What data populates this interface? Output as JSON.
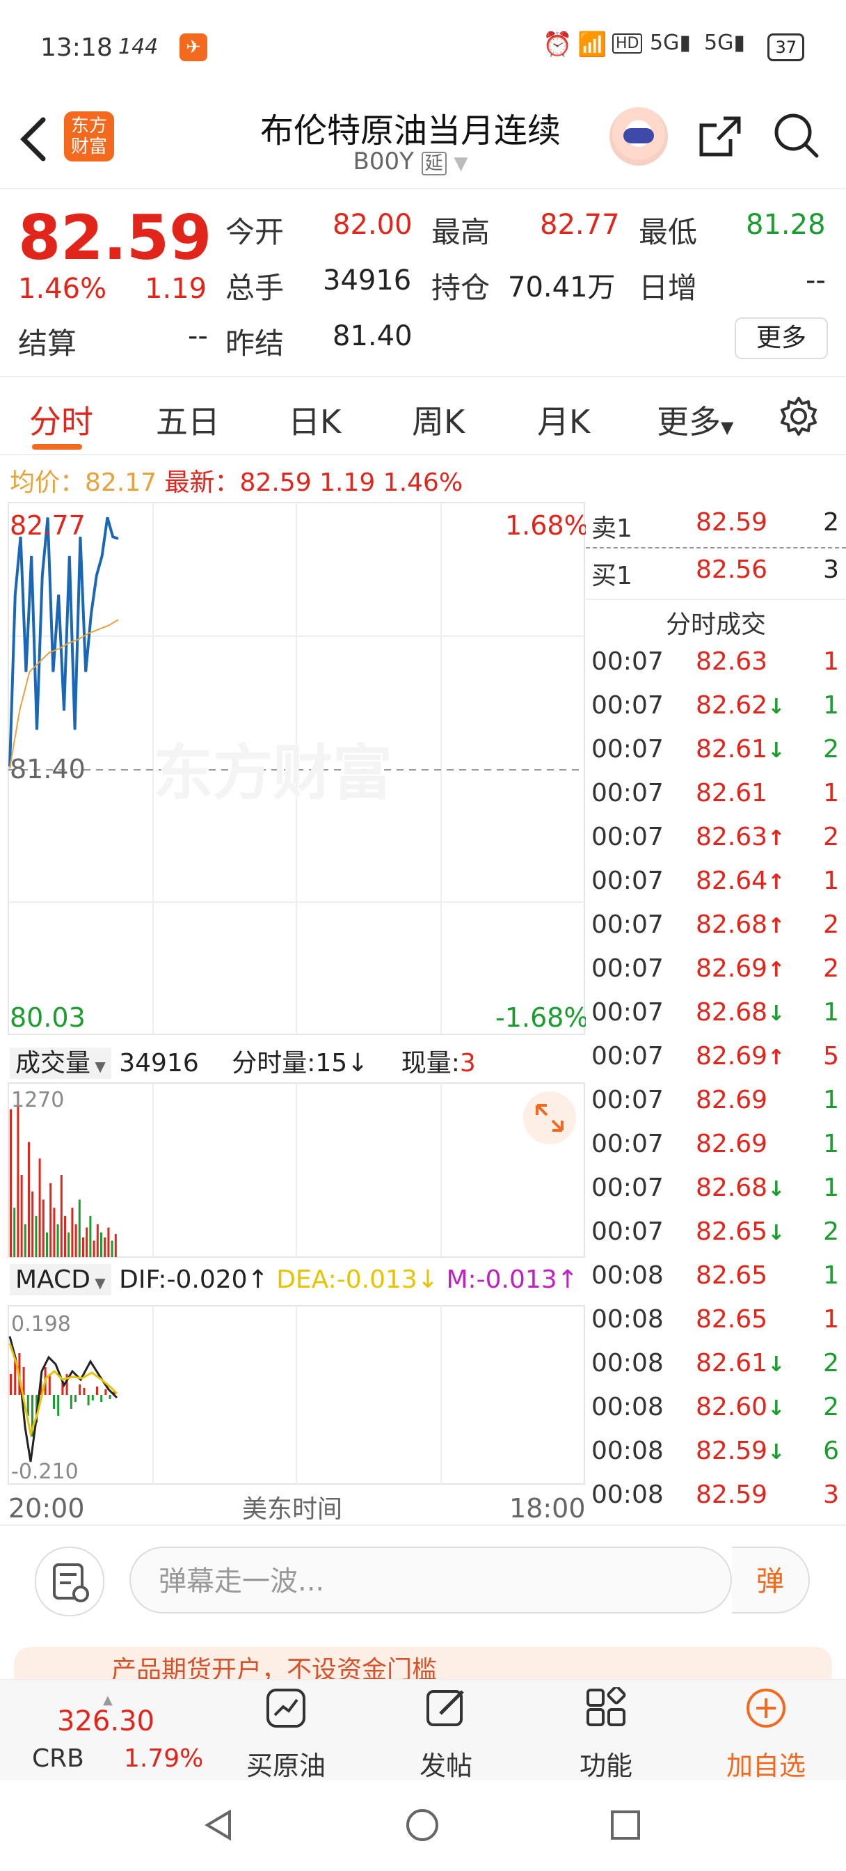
{
  "status_bar": {
    "time": "13:18",
    "refresh_rate": "144",
    "battery": "37"
  },
  "header": {
    "back_icon": "chevron-left",
    "logo_text_1": "东方",
    "logo_text_2": "财富",
    "title": "布伦特原油当月连续",
    "subtitle": "B00Y",
    "delayed_tag": "延"
  },
  "quote": {
    "price": "82.59",
    "change_pct": "1.46%",
    "change": "1.19",
    "open_label": "今开",
    "open": "82.00",
    "high_label": "最高",
    "high": "82.77",
    "low_label": "最低",
    "low": "81.28",
    "volume_label": "总手",
    "volume": "34916",
    "position_label": "持仓",
    "position": "70.41万",
    "daily_inc_label": "日增",
    "daily_inc": "--",
    "settle_label": "结算",
    "settle": "--",
    "prev_settle_label": "昨结",
    "prev_settle": "81.40",
    "more_label": "更多"
  },
  "tabs": [
    "分时",
    "五日",
    "日K",
    "周K",
    "月K",
    "更多"
  ],
  "avg_line": {
    "avg_label": "均价：",
    "avg": "82.17",
    "latest_label": "最新：",
    "latest": "82.59",
    "change": "1.19",
    "change_pct": "1.46%"
  },
  "chart": {
    "high_label": "82.77",
    "high_pct": "1.68%",
    "mid_label": "81.40",
    "low_label": "80.03",
    "low_pct": "-1.68%",
    "watermark": "东方财富",
    "vol_selector": "成交量",
    "vol_total": "34916",
    "tick_vol_label": "分时量:",
    "tick_vol": "15",
    "now_vol_label": "现量:",
    "now_vol": "3",
    "vol_max": "1270",
    "macd_selector": "MACD",
    "dif": "DIF:-0.020",
    "dea": "DEA:-0.013",
    "m": "M:-0.013",
    "macd_max": "0.198",
    "macd_min": "-0.210",
    "time_start": "20:00",
    "time_mid": "美东时间",
    "time_end": "18:00"
  },
  "chart_data": {
    "type": "line",
    "title": "",
    "ylim": [
      80.03,
      82.77
    ],
    "reference": 81.4,
    "series": [
      {
        "values": [
          81.41,
          82.3,
          82.6,
          81.9,
          82.5,
          81.6,
          82.4,
          82.7,
          81.9,
          82.3,
          81.7,
          82.5,
          81.6,
          82.6,
          81.9,
          82.2,
          82.4,
          82.5,
          82.7,
          82.6,
          82.59
        ]
      },
      {
        "values": [
          81.4,
          81.7,
          81.9,
          81.95,
          82.0,
          82.02,
          82.05,
          82.07,
          82.1,
          82.12,
          82.14,
          82.17
        ]
      }
    ]
  },
  "trades": {
    "ask_label": "卖1",
    "ask_price": "82.59",
    "ask_vol": "2",
    "bid_label": "买1",
    "bid_price": "82.56",
    "bid_vol": "3",
    "header": "分时成交",
    "rows": [
      {
        "time": "00:07",
        "price": "82.63",
        "arrow": "",
        "vol": "1",
        "dir": "r"
      },
      {
        "time": "00:07",
        "price": "82.62",
        "arrow": "↓",
        "vol": "1",
        "dir": "g"
      },
      {
        "time": "00:07",
        "price": "82.61",
        "arrow": "↓",
        "vol": "2",
        "dir": "g"
      },
      {
        "time": "00:07",
        "price": "82.61",
        "arrow": "",
        "vol": "1",
        "dir": "r"
      },
      {
        "time": "00:07",
        "price": "82.63",
        "arrow": "↑",
        "vol": "2",
        "dir": "r"
      },
      {
        "time": "00:07",
        "price": "82.64",
        "arrow": "↑",
        "vol": "1",
        "dir": "r"
      },
      {
        "time": "00:07",
        "price": "82.68",
        "arrow": "↑",
        "vol": "2",
        "dir": "r"
      },
      {
        "time": "00:07",
        "price": "82.69",
        "arrow": "↑",
        "vol": "2",
        "dir": "r"
      },
      {
        "time": "00:07",
        "price": "82.68",
        "arrow": "↓",
        "vol": "1",
        "dir": "g"
      },
      {
        "time": "00:07",
        "price": "82.69",
        "arrow": "↑",
        "vol": "5",
        "dir": "r"
      },
      {
        "time": "00:07",
        "price": "82.69",
        "arrow": "",
        "vol": "1",
        "dir": "g"
      },
      {
        "time": "00:07",
        "price": "82.69",
        "arrow": "",
        "vol": "1",
        "dir": "g"
      },
      {
        "time": "00:07",
        "price": "82.68",
        "arrow": "↓",
        "vol": "1",
        "dir": "g"
      },
      {
        "time": "00:07",
        "price": "82.65",
        "arrow": "↓",
        "vol": "2",
        "dir": "g"
      },
      {
        "time": "00:08",
        "price": "82.65",
        "arrow": "",
        "vol": "1",
        "dir": "g"
      },
      {
        "time": "00:08",
        "price": "82.65",
        "arrow": "",
        "vol": "1",
        "dir": "r"
      },
      {
        "time": "00:08",
        "price": "82.61",
        "arrow": "↓",
        "vol": "2",
        "dir": "g"
      },
      {
        "time": "00:08",
        "price": "82.60",
        "arrow": "↓",
        "vol": "2",
        "dir": "g"
      },
      {
        "time": "00:08",
        "price": "82.59",
        "arrow": "↓",
        "vol": "6",
        "dir": "g"
      },
      {
        "time": "00:08",
        "price": "82.59",
        "arrow": "",
        "vol": "3",
        "dir": "r"
      }
    ]
  },
  "comment": {
    "placeholder": "弹幕走一波...",
    "danmu_btn": "弹"
  },
  "promo": {
    "text": "产品期货开户，不设资金门槛"
  },
  "bottom_nav": {
    "crb_value": "326.30",
    "crb_label": "CRB",
    "crb_pct": "1.79%",
    "buy_oil": "买原油",
    "post": "发帖",
    "functions": "功能",
    "add_watch": "加自选"
  }
}
